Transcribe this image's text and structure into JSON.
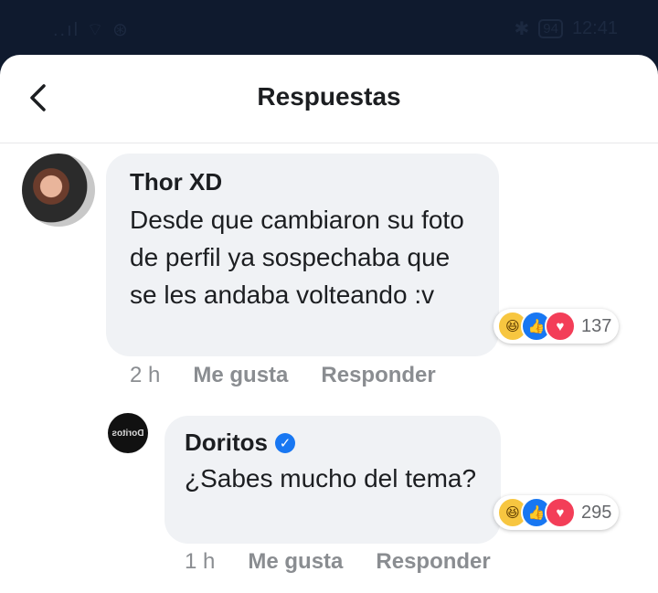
{
  "statusbar": {
    "signal": "..ıl ⌔ ⊛",
    "bt": "✱",
    "battery": "94",
    "time": "12:41"
  },
  "header": {
    "title": "Respuestas"
  },
  "comments": [
    {
      "author": "Thor XD",
      "text": "Desde que cambiaron su foto de perfil ya sospechaba que se les andaba volteando :v",
      "reaction_count": "137",
      "time": "2 h",
      "like": "Me gusta",
      "reply": "Responder"
    },
    {
      "author": "Doritos",
      "avatar_text": "Doritos",
      "text": "¿Sabes mucho del tema?",
      "reaction_count": "295",
      "time": "1 h",
      "like": "Me gusta",
      "reply": "Responder"
    }
  ],
  "reactions": {
    "haha": "😆",
    "like": "👍",
    "love": "♥"
  },
  "colors": {
    "bubble": "#f0f2f5",
    "like": "#1877f2",
    "love": "#f33e58",
    "haha": "#f7c640",
    "statusbar": "#0f1a2e"
  }
}
